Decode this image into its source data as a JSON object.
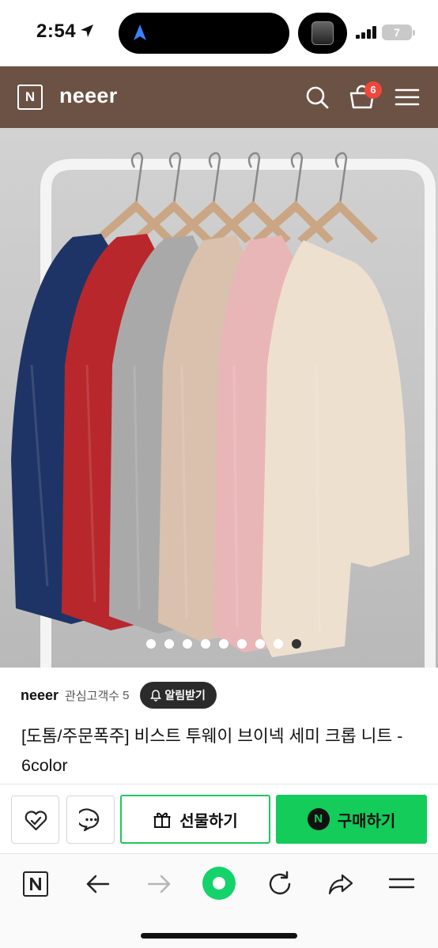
{
  "status_bar": {
    "time": "2:54",
    "battery": "7"
  },
  "header": {
    "logo_letter": "N",
    "brand": "neeer",
    "cart_count": "6",
    "icons": [
      "search-icon",
      "cart-icon",
      "menu-icon"
    ]
  },
  "gallery": {
    "dot_count": 9,
    "active_index": 8,
    "sweater_colors": [
      "#1f3466",
      "#b8272c",
      "#a9a9aa",
      "#d9c1ad",
      "#e9b6b8",
      "#eee0cf"
    ]
  },
  "store": {
    "name": "neeer",
    "follower_label": "관심고객수",
    "follower_count": "5",
    "alert_label": "알림받기"
  },
  "product": {
    "title": "[도톰/주문폭주] 비스트 투웨이 브이넥 세미 크롭 니트 - 6color"
  },
  "actions": {
    "gift_label": "선물하기",
    "buy_label": "구매하기",
    "buy_icon_letter": "N",
    "accent": "#13cc5a"
  },
  "browser": {
    "icons": [
      "naver-icon",
      "back-arrow-icon",
      "forward-arrow-icon",
      "green-home-icon",
      "reload-icon",
      "share-icon",
      "menu-icon"
    ]
  }
}
